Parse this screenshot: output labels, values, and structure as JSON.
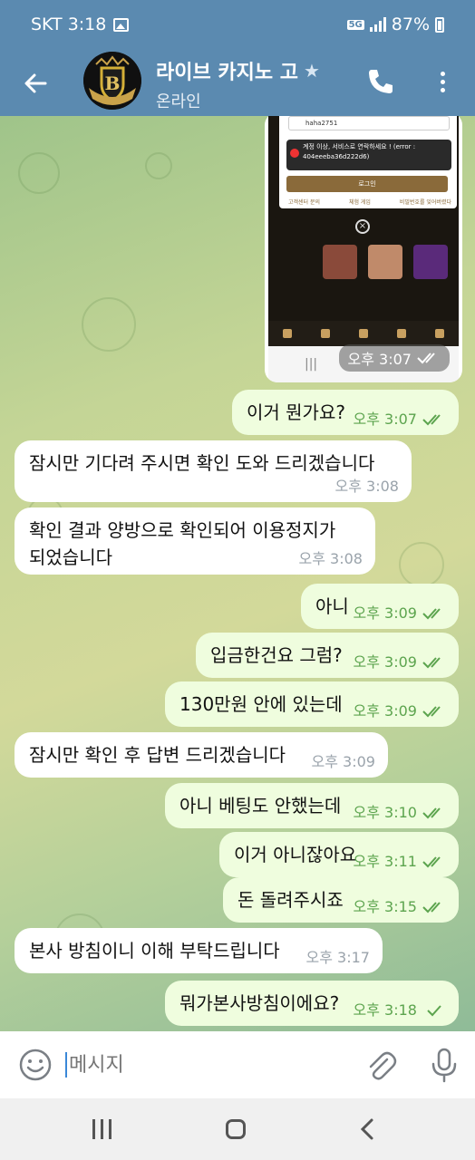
{
  "status_bar": {
    "carrier_time": "SKT 3:18",
    "network": "5G",
    "battery": "87%"
  },
  "header": {
    "title": "라이브 카지노 고",
    "status": "온라인",
    "avatar_letter": "B"
  },
  "shared_screenshot": {
    "username": "haha2751",
    "error_text": "계정 이상, 서비스로 연락하세요 ! (error : 404eeeba36d222d6)",
    "login_button": "로그인",
    "links": [
      "고객센터 문의",
      "체험 게임",
      "비밀번호를 잊어버렸다"
    ],
    "nav_labels": [
      "홈",
      "이벤트",
      "로그인",
      "가입",
      "나의"
    ],
    "time": "오후 3:07"
  },
  "messages": [
    {
      "text": "이거 뭔가요?",
      "time": "오후 3:07",
      "dir": "out"
    },
    {
      "text": "잠시만 기다려 주시면 확인 도와 드리겠습니다",
      "time": "오후 3:08",
      "dir": "in"
    },
    {
      "text": "확인 결과 양방으로 확인되어 이용정지가 되었습니다",
      "time": "오후 3:08",
      "dir": "in"
    },
    {
      "text": "아니",
      "time": "오후 3:09",
      "dir": "out"
    },
    {
      "text": "입금한건요 그럼?",
      "time": "오후 3:09",
      "dir": "out"
    },
    {
      "text": "130만원 안에 있는데",
      "time": "오후 3:09",
      "dir": "out"
    },
    {
      "text": "잠시만 확인 후 답변 드리겠습니다",
      "time": "오후 3:09",
      "dir": "in"
    },
    {
      "text": "아니 베팅도 안했는데",
      "time": "오후 3:10",
      "dir": "out"
    },
    {
      "text": "이거 아니잖아요",
      "time": "오후 3:11",
      "dir": "out"
    },
    {
      "text": "돈 돌려주시죠",
      "time": "오후 3:15",
      "dir": "out"
    },
    {
      "text": "본사 방침이니 이해 부탁드립니다",
      "time": "오후 3:17",
      "dir": "in"
    },
    {
      "text": "뭐가본사방침이에요?",
      "time": "오후 3:18",
      "dir": "out"
    }
  ],
  "input": {
    "placeholder": "메시지"
  },
  "colors": {
    "header": "#5b8ab0",
    "outgoing_bubble": "#effdde",
    "incoming_bubble": "#ffffff",
    "check_green": "#5ca44e"
  }
}
